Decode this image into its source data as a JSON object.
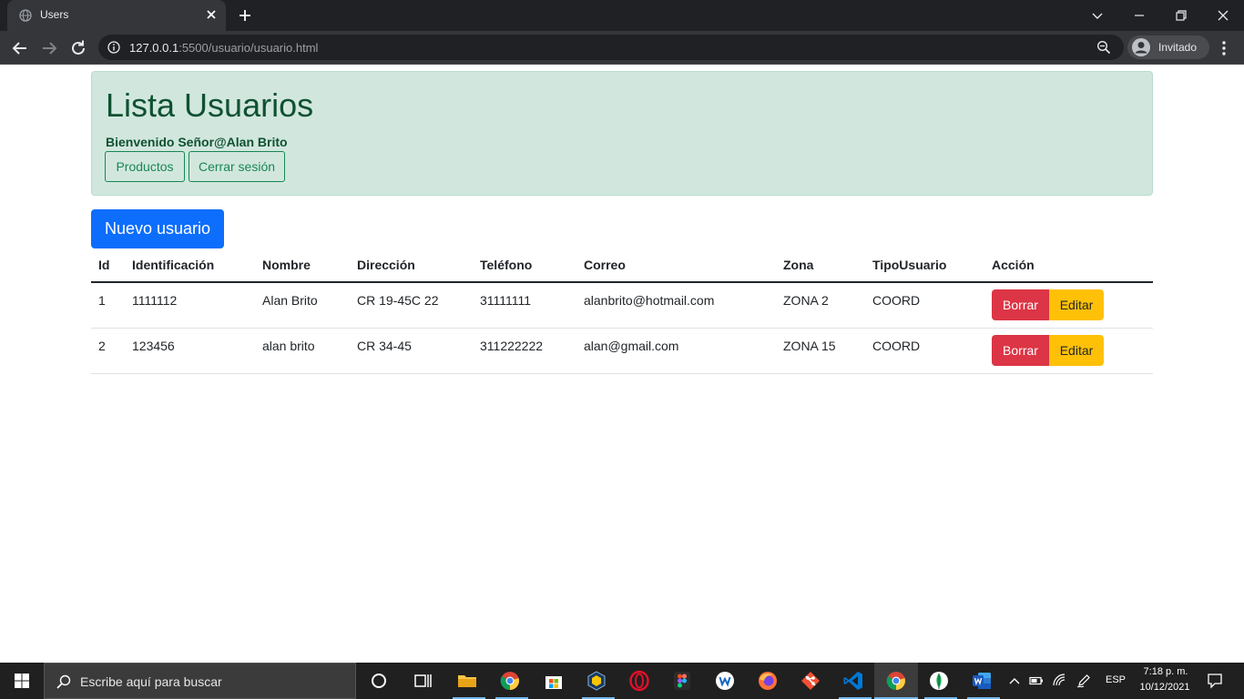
{
  "browser": {
    "tab_title": "Users",
    "url_host": "127.0.0.1",
    "url_rest": ":5500/usuario/usuario.html",
    "profile_label": "Invitado"
  },
  "page": {
    "title": "Lista Usuarios",
    "welcome": "Bienvenido Señor@Alan Brito",
    "buttons": {
      "products": "Productos",
      "logout": "Cerrar sesión",
      "new_user": "Nuevo usuario"
    },
    "table": {
      "headers": [
        "Id",
        "Identificación",
        "Nombre",
        "Dirección",
        "Teléfono",
        "Correo",
        "Zona",
        "TipoUsuario",
        "Acción"
      ],
      "rows": [
        [
          "1",
          "1111112",
          "Alan Brito",
          "CR 19-45C 22",
          "31111111",
          "alanbrito@hotmail.com",
          "ZONA 2",
          "COORD"
        ],
        [
          "2",
          "123456",
          "alan brito",
          "CR 34-45",
          "311222222",
          "alan@gmail.com",
          "ZONA 15",
          "COORD"
        ]
      ],
      "delete_label": "Borrar",
      "edit_label": "Editar"
    },
    "colors": {
      "alert_bg": "#d1e7dd",
      "alert_text": "#0f5132",
      "primary": "#0d6efd",
      "danger": "#dc3545",
      "warning": "#ffc107",
      "success": "#198754"
    }
  },
  "taskbar": {
    "search_placeholder": "Escribe aquí para buscar",
    "language": "ESP",
    "time": "7:18 p. m.",
    "date": "10/12/2021",
    "pinned_icons": [
      "cortana-icon",
      "task-view-icon",
      "file-explorer-icon",
      "chrome-icon",
      "store-icon",
      "virtualbox-icon",
      "opera-icon",
      "figma-icon",
      "app-w-icon",
      "firefox-icon",
      "git-icon",
      "vscode-icon",
      "chrome-active-icon",
      "mongodb-icon",
      "word-icon"
    ]
  }
}
